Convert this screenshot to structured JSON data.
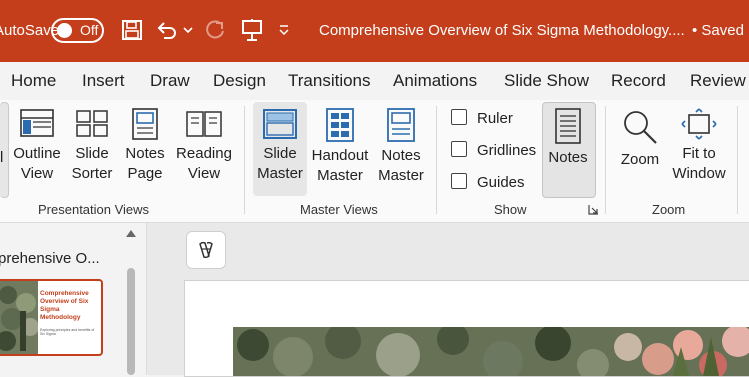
{
  "titlebar": {
    "autosave_label": "AutoSave",
    "autosave_state": "Off",
    "document_title": "Comprehensive Overview of Six Sigma Methodology....",
    "saved_status": "• Saved"
  },
  "tabs": [
    "Home",
    "Insert",
    "Draw",
    "Design",
    "Transitions",
    "Animations",
    "Slide Show",
    "Record",
    "Review"
  ],
  "ribbon": {
    "presentation_views": {
      "label": "Presentation Views",
      "normal_partial": "l",
      "outline": [
        "Outline",
        "View"
      ],
      "slide_sorter": [
        "Slide",
        "Sorter"
      ],
      "notes_page": [
        "Notes",
        "Page"
      ],
      "reading_view": [
        "Reading",
        "View"
      ]
    },
    "master_views": {
      "label": "Master Views",
      "slide_master": [
        "Slide",
        "Master"
      ],
      "handout_master": [
        "Handout",
        "Master"
      ],
      "notes_master": [
        "Notes",
        "Master"
      ]
    },
    "show": {
      "label": "Show",
      "ruler": "Ruler",
      "gridlines": "Gridlines",
      "guides": "Guides",
      "notes": "Notes"
    },
    "zoom": {
      "label": "Zoom",
      "zoom": "Zoom",
      "fit_to_window": [
        "Fit to",
        "Window"
      ]
    }
  },
  "thumbnail": {
    "section_title": "prehensive O...",
    "slide_title": "Comprehensive Overview of Six Sigma Methodology",
    "slide_subtitle": "Exploring principles and benefits of Six Sigma"
  },
  "colors": {
    "accent": "#c43e1c",
    "icon_blue": "#2b6cb0"
  },
  "icons": [
    "save-icon",
    "undo-icon",
    "redo-icon",
    "present-icon",
    "customize-icon",
    "copilot-icon"
  ]
}
